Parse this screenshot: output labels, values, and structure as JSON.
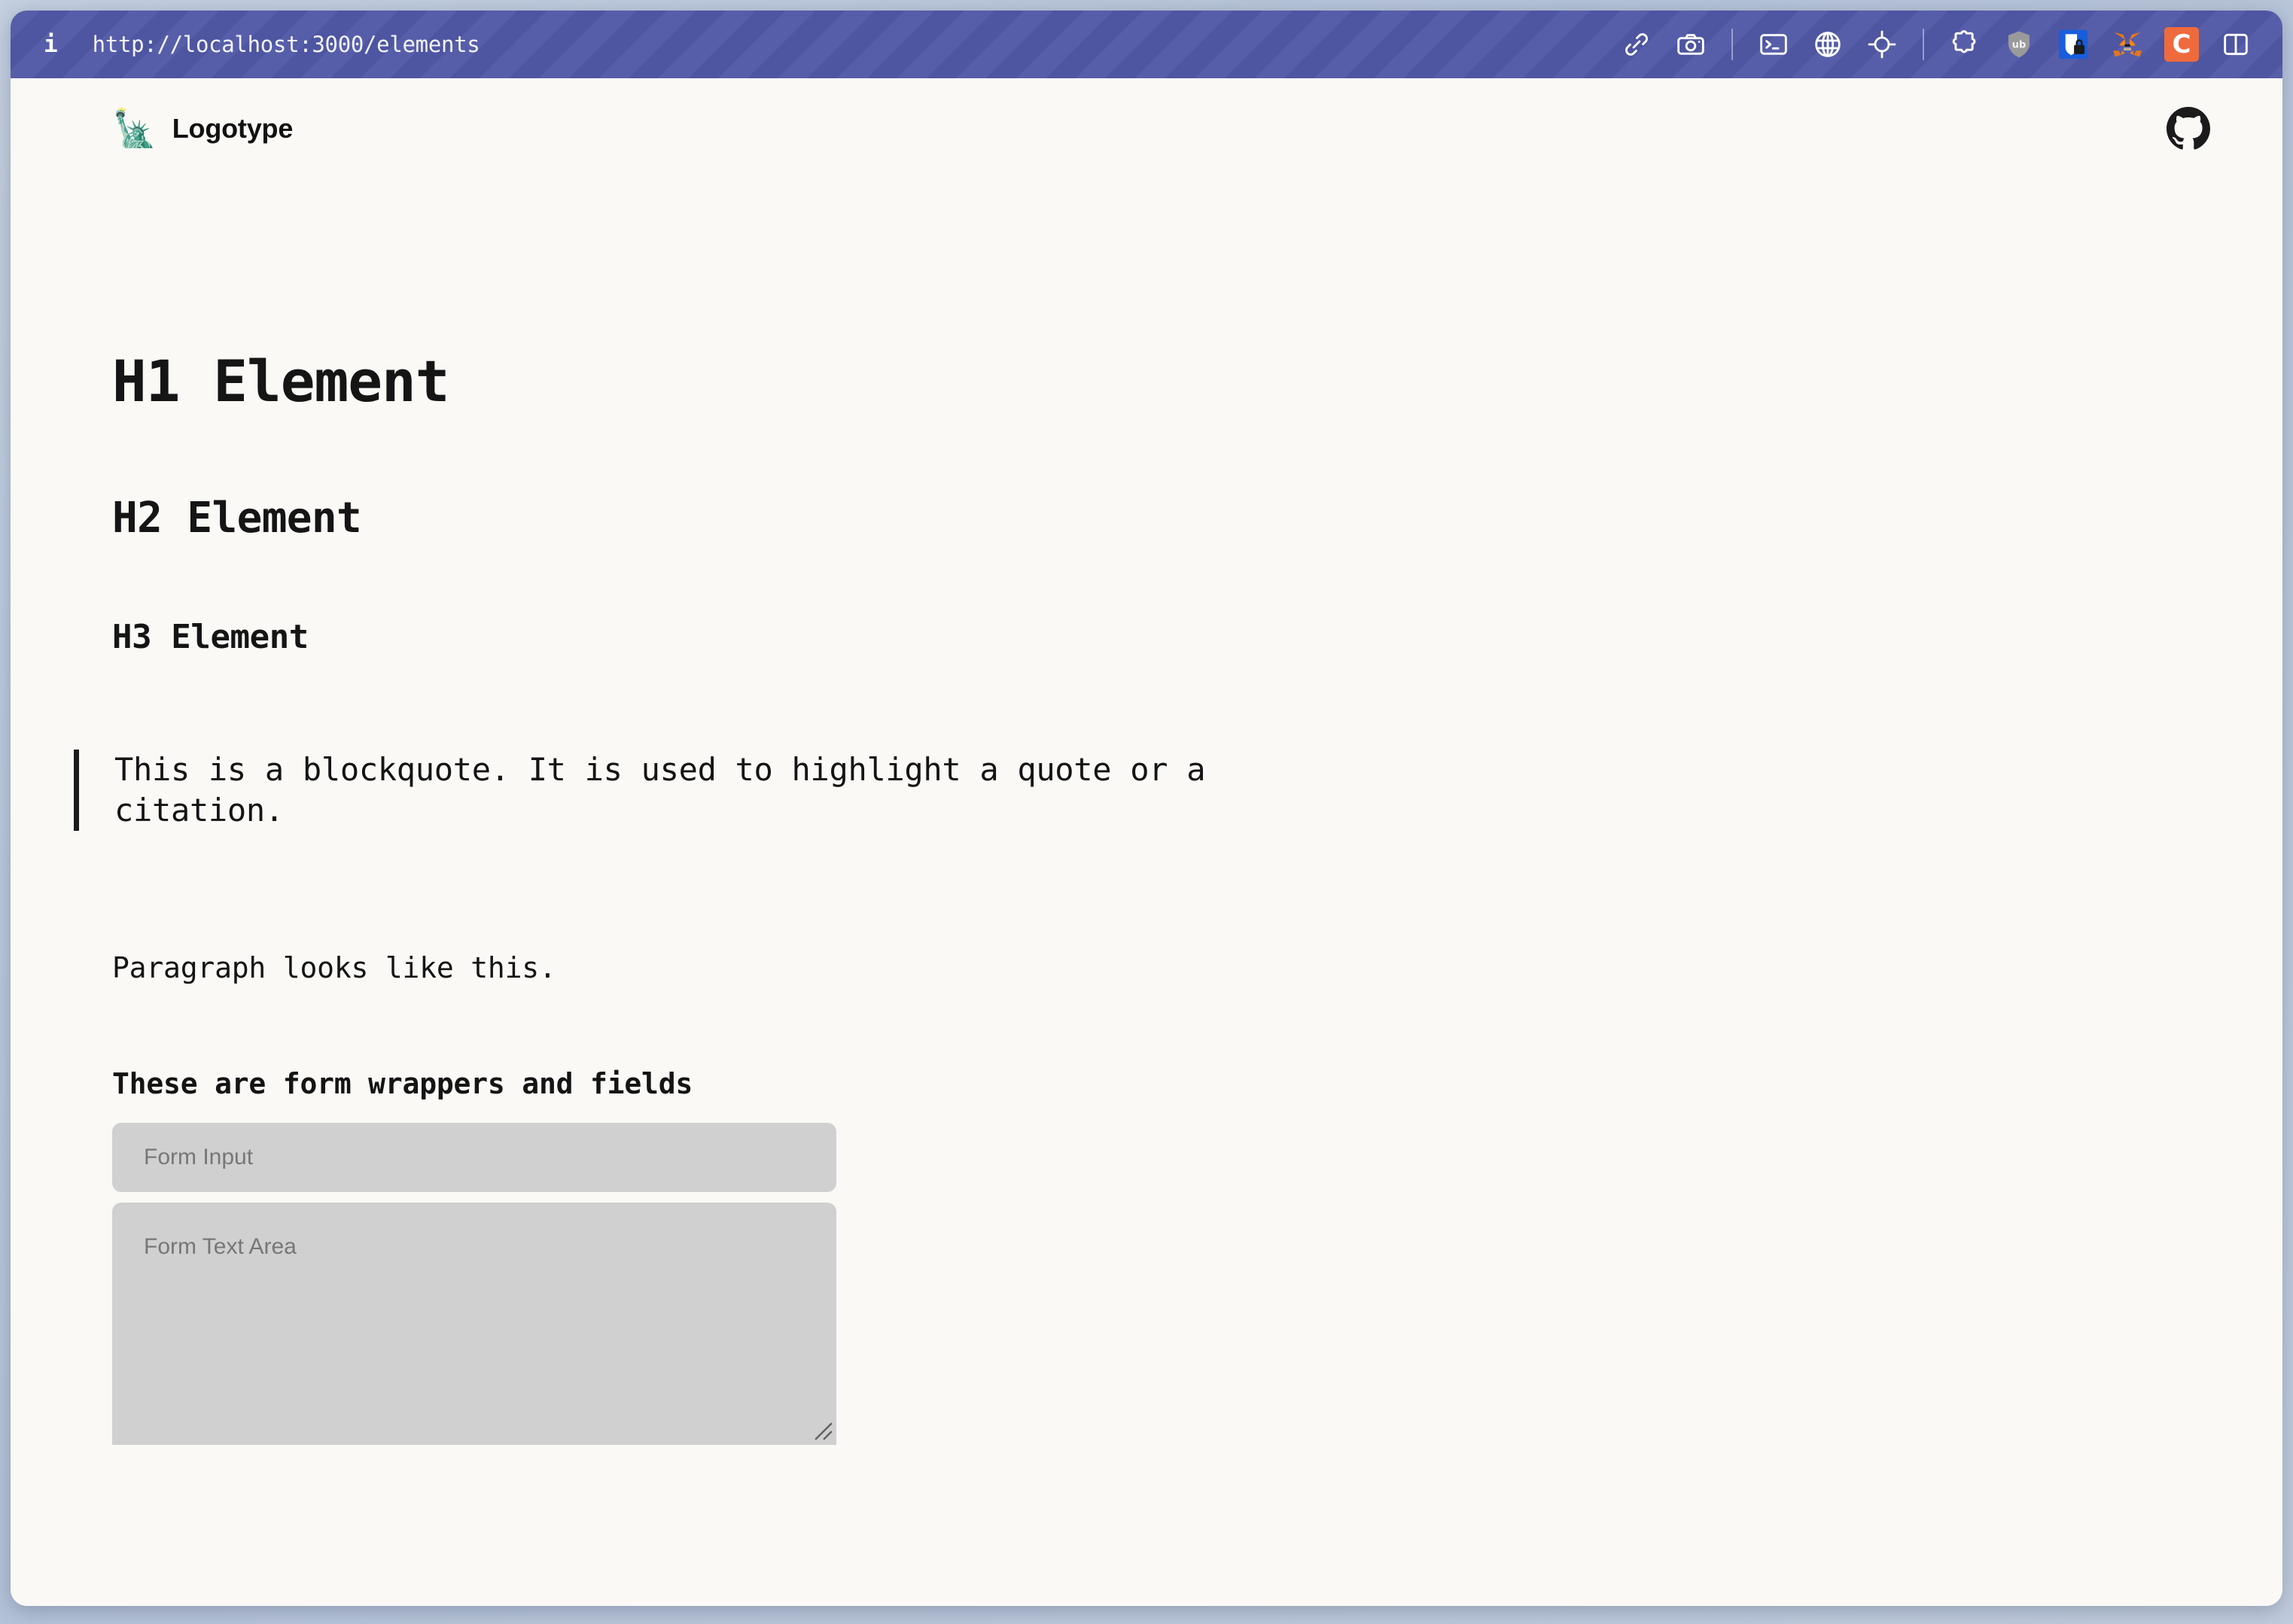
{
  "browser": {
    "info_glyph": "i",
    "url": "http://localhost:3000/elements",
    "toolbar_icons": [
      {
        "name": "link-icon",
        "label": "Copy link"
      },
      {
        "name": "camera-icon",
        "label": "Screenshot"
      },
      {
        "name": "terminal-icon",
        "label": "Console"
      },
      {
        "name": "globe-icon",
        "label": "Network"
      },
      {
        "name": "crosshair-icon",
        "label": "Inspect element"
      },
      {
        "name": "puzzle-icon",
        "label": "Extensions"
      },
      {
        "name": "ublock-origin-icon",
        "label": "uBlock Origin"
      },
      {
        "name": "bitwarden-icon",
        "label": "Bitwarden"
      },
      {
        "name": "metamask-icon",
        "label": "MetaMask"
      },
      {
        "name": "c-extension-icon",
        "label": "C"
      },
      {
        "name": "split-panel-icon",
        "label": "Toggle panel"
      }
    ],
    "ublock_label": "ub",
    "c_extension_label": "C",
    "accent_color": "#5158a6"
  },
  "site": {
    "logo_glyph": "🗽",
    "logo_name": "statue-of-liberty-icon",
    "logotype": "Logotype",
    "github_label": "GitHub"
  },
  "content": {
    "h1": "H1 Element",
    "h2": "H2 Element",
    "h3": "H3 Element",
    "blockquote": "This is a blockquote. It is used to highlight a quote or a citation.",
    "paragraph": "Paragraph looks like this.",
    "form_heading": "These are form wrappers and fields",
    "form": {
      "input_placeholder": "Form Input",
      "input_value": "",
      "textarea_placeholder": "Form Text Area",
      "textarea_value": ""
    }
  },
  "theme": {
    "page_background": "#faf9f5",
    "text_color": "#141414",
    "field_background": "#d0d0d0",
    "placeholder_color": "#777777",
    "desktop_background": "#b9c6dc"
  }
}
